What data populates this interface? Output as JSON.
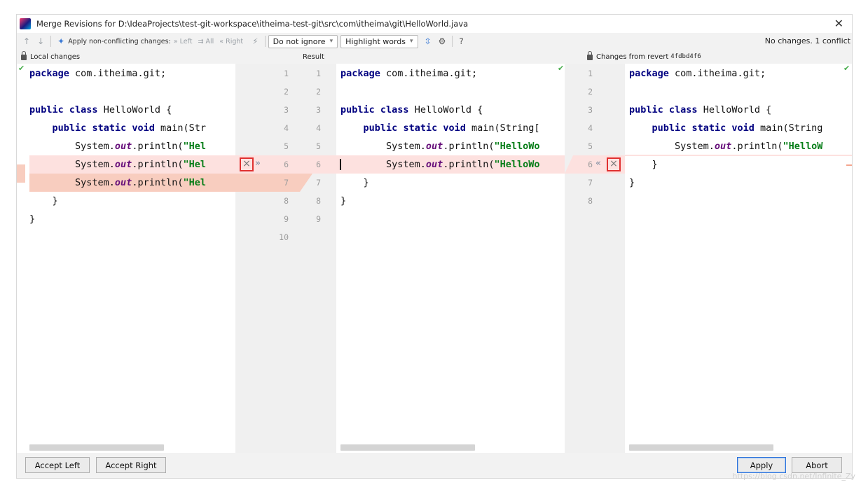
{
  "window": {
    "title": "Merge Revisions for D:\\IdeaProjects\\test-git-workspace\\itheima-test-git\\src\\com\\itheima\\git\\HelloWorld.java"
  },
  "toolbar": {
    "apply_nonconflicting": "Apply non-conflicting changes:",
    "left": "Left",
    "all": "All",
    "right": "Right",
    "ignore_select": "Do not ignore",
    "highlight_select": "Highlight words",
    "help": "?",
    "status": "No changes. 1 conflict"
  },
  "panes": {
    "left_title": "Local changes",
    "center_title": "Result",
    "right_title": "Changes from revert",
    "right_revision": "4fdbd4f6"
  },
  "left_code": [
    "package com.itheima.git;",
    "",
    "public class HelloWorld {",
    "    public static void main(Str",
    "        System.out.println(\"Hel",
    "        System.out.println(\"Hel",
    "        System.out.println(\"Hel",
    "    }",
    "}"
  ],
  "center_code": [
    "package com.itheima.git;",
    "",
    "public class HelloWorld {",
    "    public static void main(String[",
    "        System.out.println(\"HelloWo",
    "        System.out.println(\"HelloWo",
    "    }",
    "}"
  ],
  "right_code": [
    "package com.itheima.git;",
    "",
    "public class HelloWorld {",
    "    public static void main(String",
    "        System.out.println(\"HelloW",
    "    }",
    "}"
  ],
  "left_line_numbers": [
    "1",
    "2",
    "3",
    "4",
    "5",
    "6",
    "7",
    "8",
    "9",
    "10"
  ],
  "center_line_numbers": [
    "1",
    "2",
    "3",
    "4",
    "5",
    "6",
    "7",
    "8",
    "9"
  ],
  "right_line_numbers": [
    "1",
    "2",
    "3",
    "4",
    "5",
    "6",
    "7",
    "8"
  ],
  "gutter_symbols": {
    "discard": "×",
    "apply_right": "»",
    "apply_left": "«"
  },
  "buttons": {
    "accept_left": "Accept Left",
    "accept_right": "Accept Right",
    "apply": "Apply",
    "abort": "Abort"
  },
  "watermark": "https://blog.csdn.net/Infinite_Zy",
  "colors": {
    "conflict_bg": "#fde1df",
    "conflict_strong": "#f8cdbf",
    "keyword": "#000080",
    "string": "#067d17",
    "field": "#660e7a",
    "focus_border": "#2f73d9",
    "marker_border": "#e03030"
  }
}
